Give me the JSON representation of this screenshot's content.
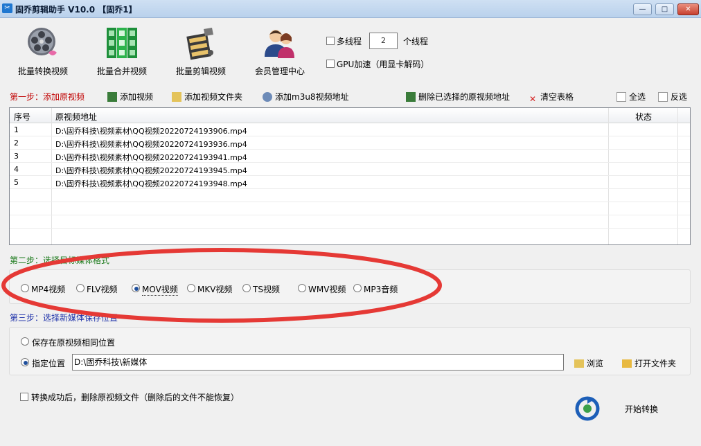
{
  "window": {
    "title": "固乔剪辑助手 V10.0  【固乔1】",
    "controls": {
      "minimize": "—",
      "maximize": "□",
      "close": "✕"
    }
  },
  "toolbar": {
    "tools": [
      {
        "label": "批量转换视频",
        "icon": "film-reel-icon"
      },
      {
        "label": "批量合并视频",
        "icon": "film-strip-icon"
      },
      {
        "label": "批量剪辑视频",
        "icon": "clapper-icon"
      },
      {
        "label": "会员管理中心",
        "icon": "users-icon"
      }
    ],
    "multithread_label": "多线程",
    "thread_count": "2",
    "thread_unit": "个线程",
    "gpu_label": "GPU加速（用显卡解码）"
  },
  "step1": {
    "title": "第一步：添加原视频",
    "add_video": "添加视频",
    "add_folder": "添加视频文件夹",
    "add_m3u8": "添加m3u8视频地址",
    "delete_selected": "删除已选择的原视频地址",
    "clear_table": "清空表格",
    "select_all": "全选",
    "invert_select": "反选"
  },
  "table": {
    "columns": [
      "序号",
      "原视频地址",
      "状态"
    ],
    "rows": [
      {
        "index": "1",
        "path": "D:\\固乔科技\\视频素材\\QQ视频20220724193906.mp4",
        "status": ""
      },
      {
        "index": "2",
        "path": "D:\\固乔科技\\视频素材\\QQ视频20220724193936.mp4",
        "status": ""
      },
      {
        "index": "3",
        "path": "D:\\固乔科技\\视频素材\\QQ视频20220724193941.mp4",
        "status": ""
      },
      {
        "index": "4",
        "path": "D:\\固乔科技\\视频素材\\QQ视频20220724193945.mp4",
        "status": ""
      },
      {
        "index": "5",
        "path": "D:\\固乔科技\\视频素材\\QQ视频20220724193948.mp4",
        "status": ""
      }
    ]
  },
  "step2": {
    "title": "第二步：选择目标媒体格式",
    "formats": [
      "MP4视频",
      "FLV视频",
      "MOV视频",
      "MKV视频",
      "TS视频",
      "WMV视频",
      "MP3音频"
    ],
    "selected": "MOV视频"
  },
  "step3": {
    "title": "第三步：选择新媒体保存位置",
    "same_location": "保存在原视频相同位置",
    "custom_location": "指定位置",
    "path_value": "D:\\固乔科技\\新媒体",
    "browse": "浏览",
    "open_folder": "打开文件夹"
  },
  "footer": {
    "delete_after": "转换成功后，删除原视频文件（删除后的文件不能恢复）",
    "start": "开始转换"
  },
  "colors": {
    "annotation": "#e53935",
    "step1": "#c00000",
    "step2": "#1b7a1b",
    "step3": "#1a2ea8"
  }
}
